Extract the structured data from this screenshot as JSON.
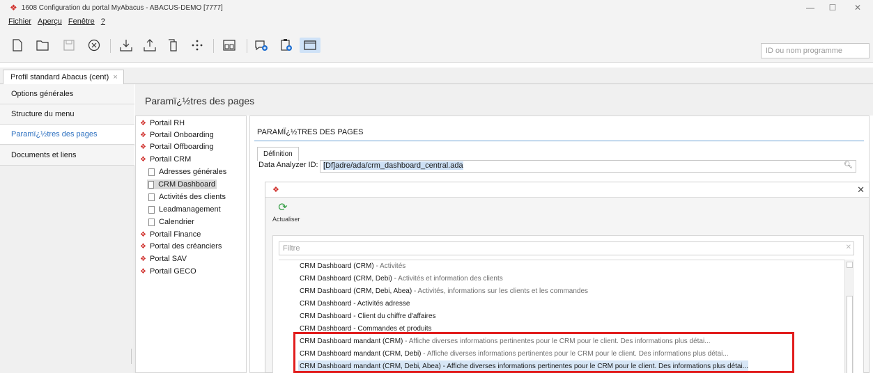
{
  "window": {
    "title": "1608 Configuration du portal MyAbacus - ABACUS-DEMO [7777]",
    "controls": {
      "minimize": "—",
      "maximize": "☐",
      "close": "✕"
    }
  },
  "menu": [
    "Fichier",
    "Aperçu",
    "Fenêtre",
    "?"
  ],
  "toolbar": {
    "icons": [
      "new-icon",
      "open-icon",
      "save-icon",
      "cancel-icon",
      "download-icon",
      "upload-icon",
      "copy-icon",
      "move-icon",
      "calculator-icon",
      "chat-add-icon",
      "clipboard-add-icon",
      "window-icon"
    ],
    "search_placeholder": "ID ou nom programme"
  },
  "tab": {
    "label": "Profil standard Abacus (cent)",
    "close": "×"
  },
  "nav": {
    "items": [
      "Options générales",
      "Structure du menu",
      "Paramï¿½tres des pages",
      "Documents et liens"
    ],
    "active": 2
  },
  "page": {
    "heading": "Paramï¿½tres des pages"
  },
  "tree": {
    "nodes": [
      {
        "label": "Portail RH",
        "type": "portal"
      },
      {
        "label": "Portail Onboarding",
        "type": "portal"
      },
      {
        "label": "Portail Offboarding",
        "type": "portal"
      },
      {
        "label": "Portail CRM",
        "type": "portal"
      },
      {
        "label": "Adresses générales",
        "type": "page"
      },
      {
        "label": "CRM Dashboard",
        "type": "page",
        "selected": true
      },
      {
        "label": "Activités des clients",
        "type": "page"
      },
      {
        "label": "Leadmanagement",
        "type": "page"
      },
      {
        "label": "Calendrier",
        "type": "page"
      },
      {
        "label": "Portail Finance",
        "type": "portal"
      },
      {
        "label": "Portal des créanciers",
        "type": "portal"
      },
      {
        "label": "Portal SAV",
        "type": "portal"
      },
      {
        "label": "Portail GECO",
        "type": "portal"
      }
    ]
  },
  "content": {
    "title": "PARAMÏ¿½TRES DES PAGES",
    "tab": "Définition",
    "field_label": "Data Analyzer ID:",
    "field_value": "[Df]adre/ada/crm_dashboard_central.ada"
  },
  "dialog": {
    "refresh_label": "Actualiser",
    "filter_placeholder": "Filtre",
    "rows": [
      {
        "name": "CRM Dashboard (CRM)",
        "desc": " - Activités"
      },
      {
        "name": "CRM Dashboard (CRM, Debi)",
        "desc": " - Activités et information des clients"
      },
      {
        "name": "CRM Dashboard (CRM, Debi, Abea)",
        "desc": " - Activités, informations sur les clients et les commandes"
      },
      {
        "name": "CRM Dashboard - Activités adresse",
        "desc": ""
      },
      {
        "name": "CRM Dashboard - Client du chiffre d'affaires",
        "desc": ""
      },
      {
        "name": "CRM Dashboard - Commandes et produits",
        "desc": ""
      },
      {
        "name": "CRM Dashboard mandant (CRM)",
        "desc": " - Affiche diverses informations pertinentes pour le CRM pour le client. Des informations plus détai..."
      },
      {
        "name": "CRM Dashboard mandant (CRM, Debi)",
        "desc": " - Affiche diverses informations pertinentes pour le CRM pour le client. Des informations plus détai..."
      },
      {
        "name": "CRM Dashboard mandant (CRM, Debi, Abea) - Affiche diverses informations pertinentes pour le CRM pour le client. Des informations plus détai...",
        "desc": "",
        "selected": true
      }
    ]
  },
  "colors": {
    "accent": "#2a6ebf",
    "brand": "#d0312d",
    "highlight_box": "#e11d1d",
    "selection": "#d7e6f6"
  }
}
